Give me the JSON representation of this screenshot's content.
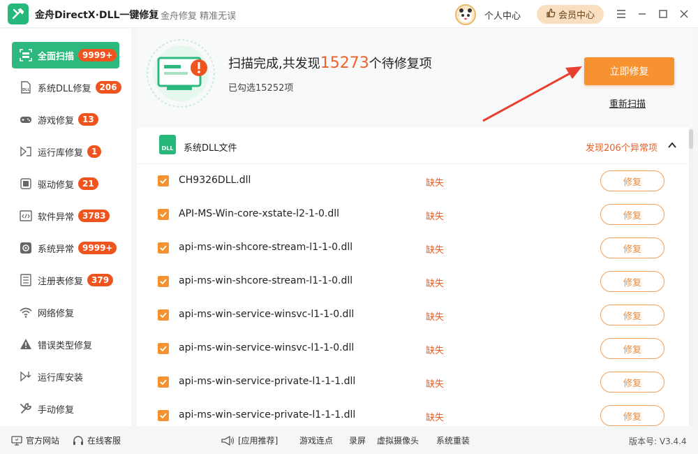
{
  "window": {
    "title": "金舟DirectX·DLL一键修复",
    "subtitle": "金舟修复 精准无误",
    "personal_center": "个人中心",
    "vip_center": "会员中心"
  },
  "sidebar": {
    "items": [
      {
        "label": "全面扫描",
        "badge": "9999+",
        "icon": "scan-icon"
      },
      {
        "label": "系统DLL修复",
        "badge": "206",
        "icon": "dll-icon"
      },
      {
        "label": "游戏修复",
        "badge": "13",
        "icon": "gamepad-icon"
      },
      {
        "label": "运行库修复",
        "badge": "1",
        "icon": "runtime-icon"
      },
      {
        "label": "驱动修复",
        "badge": "21",
        "icon": "driver-icon"
      },
      {
        "label": "软件异常",
        "badge": "3783",
        "icon": "code-icon"
      },
      {
        "label": "系统异常",
        "badge": "9999+",
        "icon": "gear-icon"
      },
      {
        "label": "注册表修复",
        "badge": "379",
        "icon": "list-icon"
      },
      {
        "label": "网络修复",
        "badge": "",
        "icon": "wifi-icon"
      },
      {
        "label": "错误类型修复",
        "badge": "",
        "icon": "warning-icon"
      },
      {
        "label": "运行库安装",
        "badge": "",
        "icon": "install-icon"
      },
      {
        "label": "手动修复",
        "badge": "",
        "icon": "wrench-icon"
      }
    ]
  },
  "scan": {
    "line1_prefix": "扫描完成,共发现",
    "count": "15273",
    "line1_suffix": "个待修复项",
    "selected": "已勾选15252项",
    "repair_now": "立即修复",
    "rescan": "重新扫描"
  },
  "group": {
    "icon_text": "DLL",
    "title": "系统DLL文件",
    "found": "发现206个异常项"
  },
  "rows": [
    {
      "file": "CH9326DLL.dll",
      "status": "缺失",
      "action": "修复"
    },
    {
      "file": "API-MS-Win-core-xstate-l2-1-0.dll",
      "status": "缺失",
      "action": "修复"
    },
    {
      "file": "api-ms-win-shcore-stream-l1-1-0.dll",
      "status": "缺失",
      "action": "修复"
    },
    {
      "file": "api-ms-win-shcore-stream-l1-1-0.dll",
      "status": "缺失",
      "action": "修复"
    },
    {
      "file": "api-ms-win-service-winsvc-l1-1-0.dll",
      "status": "缺失",
      "action": "修复"
    },
    {
      "file": "api-ms-win-service-winsvc-l1-1-0.dll",
      "status": "缺失",
      "action": "修复"
    },
    {
      "file": "api-ms-win-service-private-l1-1-1.dll",
      "status": "缺失",
      "action": "修复"
    },
    {
      "file": "api-ms-win-service-private-l1-1-1.dll",
      "status": "缺失",
      "action": "修复"
    }
  ],
  "footer": {
    "official_site": "官方网站",
    "online_support": "在线客服",
    "recommend": "[应用推荐]",
    "links": [
      "游戏连点",
      "录屏",
      "虚拟摄像头",
      "系统重装"
    ],
    "version": "版本号: V3.4.4"
  },
  "colors": {
    "accent_green": "#2db87d",
    "badge_orange": "#f0541e",
    "repair_orange": "#f69230",
    "status_text": "#e65f27"
  }
}
